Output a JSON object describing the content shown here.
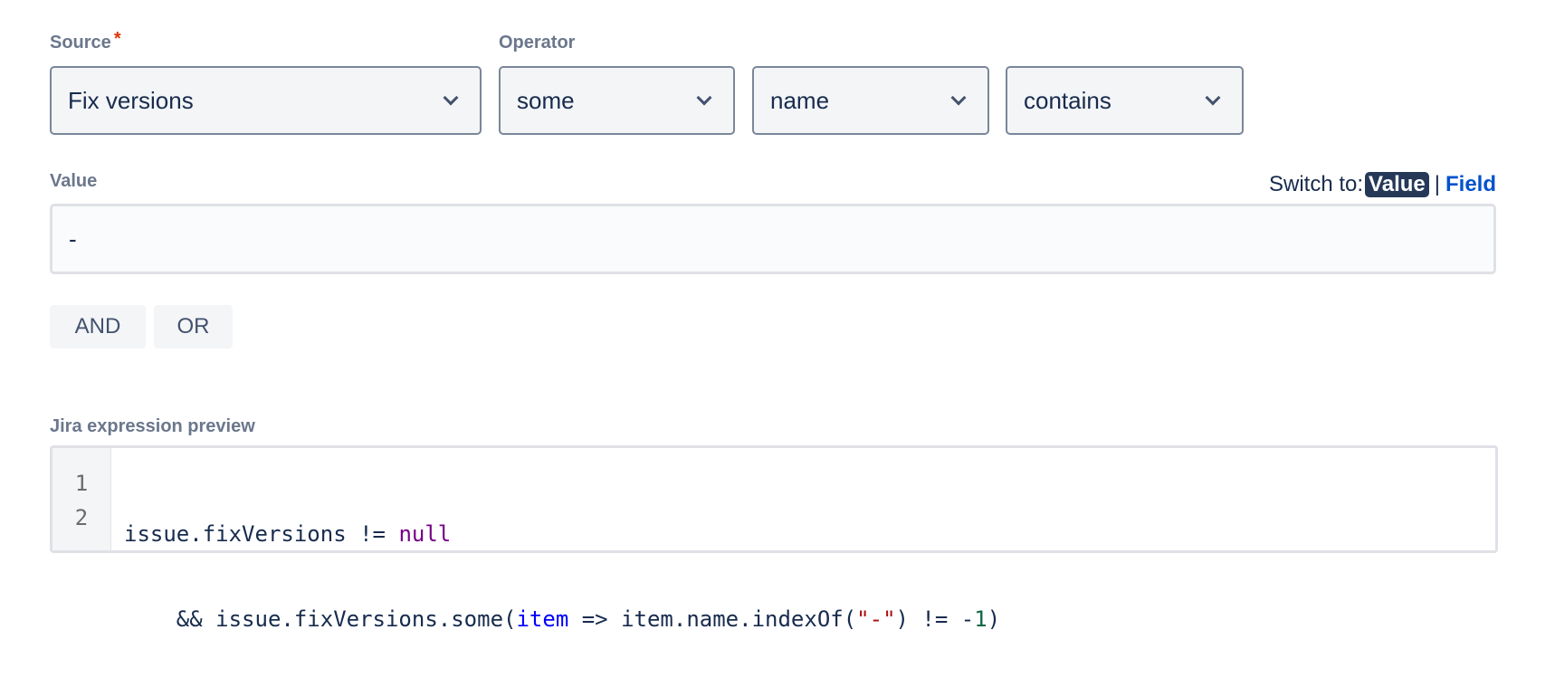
{
  "source": {
    "label": "Source",
    "required_mark": "*",
    "value": "Fix versions"
  },
  "operator": {
    "label": "Operator",
    "quantifier": "some",
    "property": "name",
    "comparison": "contains"
  },
  "value": {
    "label": "Value",
    "input_value": "-",
    "switch_label": "Switch to:",
    "switch_active": "Value",
    "switch_separator": "|",
    "switch_other": "Field"
  },
  "logic_buttons": {
    "and": "AND",
    "or": "OR"
  },
  "preview": {
    "label": "Jira expression preview",
    "line_numbers": [
      "1",
      "2"
    ],
    "line1": {
      "a": "issue.fixVersions != ",
      "kw": "null"
    },
    "line2": {
      "a": "    && issue.fixVersions.some(",
      "var": "item",
      "b": " => item.name.indexOf(",
      "str": "\"-\"",
      "c": ") != -",
      "num": "1",
      "d": ")"
    }
  }
}
